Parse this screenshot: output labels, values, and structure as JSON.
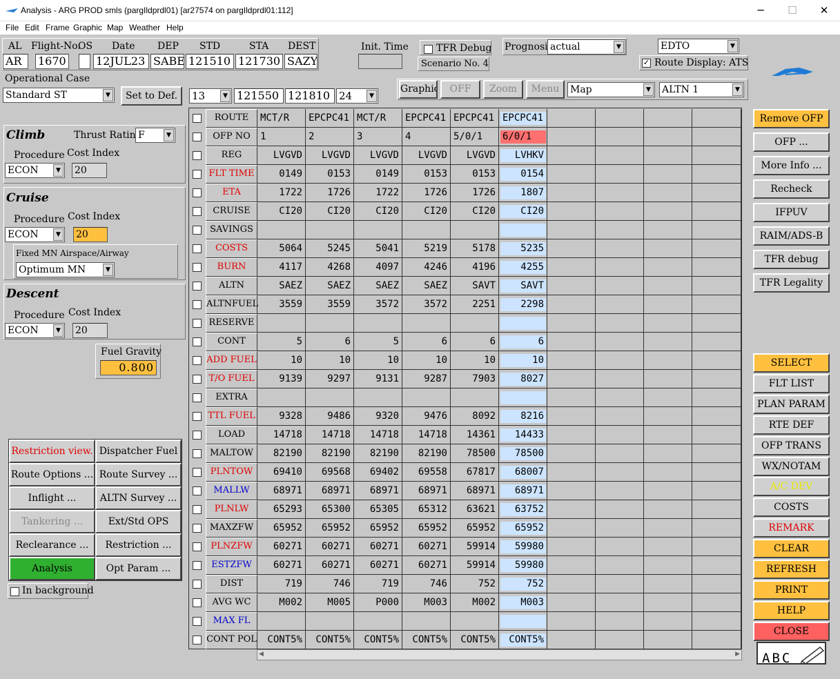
{
  "window": {
    "title": "Analysis - ARG PROD smls (pargIldprdl01) [ar27574 on pargIldprdl01:112]",
    "min": "─",
    "max": "☐",
    "close": "✕"
  },
  "menu": [
    "File",
    "Edit",
    "Frame",
    "Graphic",
    "Map",
    "Weather",
    "Help"
  ],
  "flight": {
    "headers": {
      "al": "AL",
      "flight_no": "Flight-No.",
      "os": "OS",
      "date": "Date",
      "dep": "DEP",
      "std": "STD",
      "sta": "STA",
      "dest": "DEST"
    },
    "values": {
      "al": "AR",
      "flight_no": "1670",
      "os": "",
      "date": "12JUL23",
      "dep": "SABE",
      "std": "121510",
      "sta": "121730",
      "dest": "SAZY"
    }
  },
  "init_time": {
    "label": "Init. Time",
    "value": ""
  },
  "tfr_debug": {
    "label": "TFR Debug",
    "checked": false
  },
  "scenario": "Scenario No. 4",
  "prognosis": {
    "label": "Prognosis",
    "value": "actual"
  },
  "edto": {
    "value": "EDTO"
  },
  "route_display": {
    "label": "Route Display: ATS",
    "checked": true
  },
  "operational_case": {
    "label": "Operational Case",
    "value": "Standard ST",
    "set_default": "Set to Def."
  },
  "time_selects": {
    "a": "13",
    "b": "121550",
    "c": "121810",
    "d": "24"
  },
  "toolbar": {
    "graphic": "Graphic",
    "off": "OFF",
    "zoom": "Zoom",
    "menu": "Menu",
    "map": "Map",
    "altn_label": "ALTN",
    "altn_value": "1"
  },
  "climb": {
    "title": "Climb",
    "thrust_label": "Thrust Rating",
    "thrust_value": "F",
    "proc_label": "Procedure",
    "proc_value": "ECON",
    "ci_label": "Cost Index",
    "ci_value": "20"
  },
  "cruise": {
    "title": "Cruise",
    "proc_label": "Procedure",
    "proc_value": "ECON",
    "ci_label": "Cost Index",
    "ci_value": "20",
    "fixed_label": "Fixed MN Airspace/Airway",
    "fixed_value": "Optimum MN"
  },
  "descent": {
    "title": "Descent",
    "proc_label": "Procedure",
    "proc_value": "ECON",
    "ci_label": "Cost Index",
    "ci_value": "20"
  },
  "fuel_gravity": {
    "label": "Fuel Gravity",
    "value": "0.800"
  },
  "left_buttons": [
    [
      "Restriction view.",
      "Dispatcher Fuel"
    ],
    [
      "Route Options ...",
      "Route Survey ..."
    ],
    [
      "Inflight ...",
      "ALTN Survey ..."
    ],
    [
      "Tankering ...",
      "Ext/Std OPS"
    ],
    [
      "Reclearance ...",
      "Restriction ..."
    ],
    [
      "Analysis",
      "Opt Param ..."
    ]
  ],
  "in_background": "In background",
  "table": {
    "rows": [
      {
        "label": "ROUTE",
        "color": "#000000",
        "cells": [
          "MCT/R",
          "EPCPC41",
          "MCT/R",
          "EPCPC41",
          "EPCPC41",
          "EPCPC41"
        ],
        "align": "left"
      },
      {
        "label": "OFP NO",
        "color": "#000000",
        "cells": [
          "1",
          "2",
          "3",
          "4",
          "5/0/1",
          "6/0/1"
        ],
        "align": "left"
      },
      {
        "label": "REG",
        "color": "#000000",
        "cells": [
          "LVGVD",
          "LVGVD",
          "LVGVD",
          "LVGVD",
          "LVGVD",
          "LVHKV"
        ]
      },
      {
        "label": "FLT TIME",
        "color": "#e00000",
        "cells": [
          "0149",
          "0153",
          "0149",
          "0153",
          "0153",
          "0154"
        ]
      },
      {
        "label": "ETA",
        "color": "#e00000",
        "cells": [
          "1722",
          "1726",
          "1722",
          "1726",
          "1726",
          "1807"
        ]
      },
      {
        "label": "CRUISE",
        "color": "#000000",
        "cells": [
          "CI20",
          "CI20",
          "CI20",
          "CI20",
          "CI20",
          "CI20"
        ]
      },
      {
        "label": "SAVINGS",
        "color": "#000000",
        "cells": [
          "",
          "",
          "",
          "",
          "",
          ""
        ]
      },
      {
        "label": "COSTS",
        "color": "#e00000",
        "cells": [
          "5064",
          "5245",
          "5041",
          "5219",
          "5178",
          "5235"
        ]
      },
      {
        "label": "BURN OFF",
        "color": "#e00000",
        "cells": [
          "4117",
          "4268",
          "4097",
          "4246",
          "4196",
          "4255"
        ]
      },
      {
        "label": "ALTN",
        "color": "#000000",
        "cells": [
          "SAEZ",
          "SAEZ",
          "SAEZ",
          "SAEZ",
          "SAVT",
          "SAVT"
        ]
      },
      {
        "label": "ALTNFUEL",
        "color": "#000000",
        "cells": [
          "3559",
          "3559",
          "3572",
          "3572",
          "2251",
          "2298"
        ]
      },
      {
        "label": "RESERVE",
        "color": "#000000",
        "cells": [
          "",
          "",
          "",
          "",
          "",
          ""
        ]
      },
      {
        "label": "CONT",
        "color": "#000000",
        "cells": [
          "5",
          "6",
          "5",
          "6",
          "6",
          "6"
        ]
      },
      {
        "label": "ADD FUEL",
        "color": "#e00000",
        "cells": [
          "10",
          "10",
          "10",
          "10",
          "10",
          "10"
        ]
      },
      {
        "label": "T/O FUEL",
        "color": "#e00000",
        "cells": [
          "9139",
          "9297",
          "9131",
          "9287",
          "7903",
          "8027"
        ]
      },
      {
        "label": "EXTRA",
        "color": "#000000",
        "cells": [
          "",
          "",
          "",
          "",
          "",
          ""
        ]
      },
      {
        "label": "TTL FUEL",
        "color": "#e00000",
        "cells": [
          "9328",
          "9486",
          "9320",
          "9476",
          "8092",
          "8216"
        ]
      },
      {
        "label": "LOAD",
        "color": "#000000",
        "cells": [
          "14718",
          "14718",
          "14718",
          "14718",
          "14361",
          "14433"
        ]
      },
      {
        "label": "MALTOW",
        "color": "#000000",
        "cells": [
          "82190",
          "82190",
          "82190",
          "82190",
          "78500",
          "78500"
        ]
      },
      {
        "label": "PLNTOW",
        "color": "#e00000",
        "cells": [
          "69410",
          "69568",
          "69402",
          "69558",
          "67817",
          "68007"
        ]
      },
      {
        "label": "MALLW",
        "color": "#0000cc",
        "cells": [
          "68971",
          "68971",
          "68971",
          "68971",
          "68971",
          "68971"
        ]
      },
      {
        "label": "PLNLW",
        "color": "#e00000",
        "cells": [
          "65293",
          "65300",
          "65305",
          "65312",
          "63621",
          "63752"
        ]
      },
      {
        "label": "MAXZFW",
        "color": "#000000",
        "cells": [
          "65952",
          "65952",
          "65952",
          "65952",
          "65952",
          "65952"
        ]
      },
      {
        "label": "PLNZFW",
        "color": "#e00000",
        "cells": [
          "60271",
          "60271",
          "60271",
          "60271",
          "59914",
          "59980"
        ]
      },
      {
        "label": "ESTZFW",
        "color": "#0000cc",
        "cells": [
          "60271",
          "60271",
          "60271",
          "60271",
          "59914",
          "59980"
        ]
      },
      {
        "label": "DIST",
        "color": "#000000",
        "cells": [
          "719",
          "746",
          "719",
          "746",
          "752",
          "752"
        ]
      },
      {
        "label": "AVG WC",
        "color": "#000000",
        "cells": [
          "M002",
          "M005",
          "P000",
          "M003",
          "M002",
          "M003"
        ]
      },
      {
        "label": "MAX FL",
        "color": "#0000cc",
        "cells": [
          "",
          "",
          "",
          "",
          "",
          ""
        ]
      },
      {
        "label": "CONT POL",
        "color": "#000000",
        "cells": [
          "CONT5%",
          "CONT5%",
          "CONT5%",
          "CONT5%",
          "CONT5%",
          "CONT5%"
        ]
      }
    ]
  },
  "right_top_buttons": [
    {
      "label": "Remove OFP",
      "bg": "#ffc040",
      "color": "#000"
    },
    {
      "label": "OFP ...",
      "bg": "#d0d0d0",
      "color": "#000"
    },
    {
      "label": "More Info ...",
      "bg": "#d0d0d0",
      "color": "#000"
    },
    {
      "label": "Recheck",
      "bg": "#d0d0d0",
      "color": "#000"
    },
    {
      "label": "IFPUV",
      "bg": "#d0d0d0",
      "color": "#000"
    },
    {
      "label": "RAIM/ADS-B",
      "bg": "#d0d0d0",
      "color": "#000"
    },
    {
      "label": "TFR debug",
      "bg": "#d0d0d0",
      "color": "#000"
    },
    {
      "label": "TFR Legality",
      "bg": "#d0d0d0",
      "color": "#000"
    }
  ],
  "right_bottom_buttons": [
    {
      "label": "SELECT",
      "bg": "#ffc040",
      "color": "#000"
    },
    {
      "label": "FLT LIST",
      "bg": "#d0d0d0",
      "color": "#000"
    },
    {
      "label": "PLAN PARAM",
      "bg": "#d0d0d0",
      "color": "#000"
    },
    {
      "label": "RTE DEF",
      "bg": "#d0d0d0",
      "color": "#000"
    },
    {
      "label": "OFP TRANS",
      "bg": "#d0d0d0",
      "color": "#000"
    },
    {
      "label": "WX/NOTAM",
      "bg": "#d0d0d0",
      "color": "#000"
    },
    {
      "label": "A/C DEV",
      "bg": "#d0d0d0",
      "color": "#e8e800"
    },
    {
      "label": "COSTS",
      "bg": "#d0d0d0",
      "color": "#000"
    },
    {
      "label": "REMARK",
      "bg": "#d0d0d0",
      "color": "#e00000"
    },
    {
      "label": "CLEAR",
      "bg": "#ffc040",
      "color": "#000"
    },
    {
      "label": "REFRESH",
      "bg": "#ffc040",
      "color": "#000"
    },
    {
      "label": "PRINT",
      "bg": "#ffc040",
      "color": "#000"
    },
    {
      "label": "HELP",
      "bg": "#ffc040",
      "color": "#000"
    },
    {
      "label": "CLOSE",
      "bg": "#ff6060",
      "color": "#000"
    }
  ],
  "notepad": "ABC"
}
